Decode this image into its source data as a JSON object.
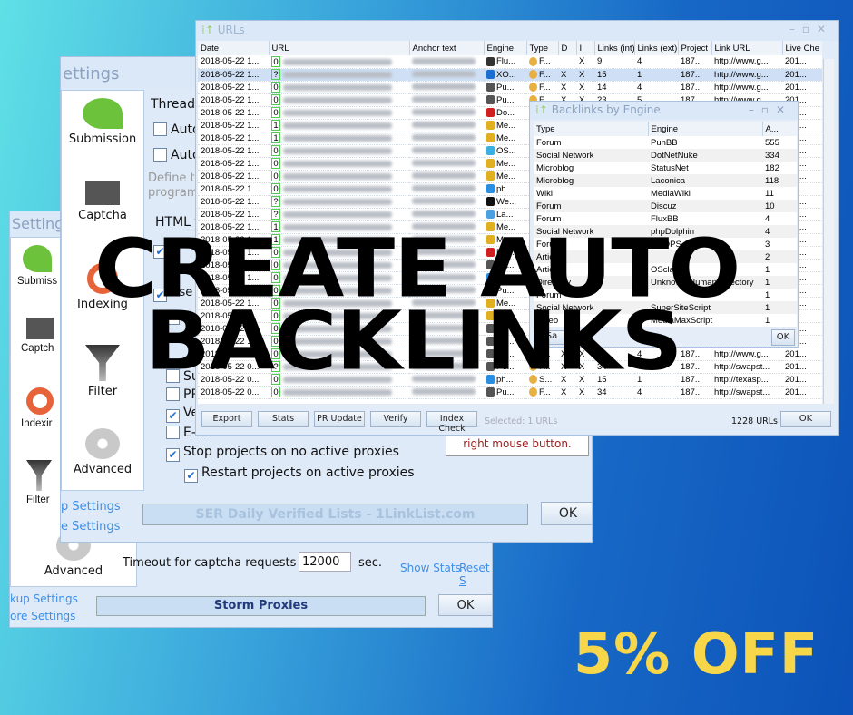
{
  "back_window": {
    "title": "Setting",
    "sidebar": [
      "Submiss",
      "Captch",
      "Indexir",
      "Filter",
      "Advanced"
    ],
    "timeout_label": "Timeout for captcha requests to solve",
    "timeout_value": "12000",
    "timeout_unit": "sec.",
    "show_stats": "Show Stats",
    "reset": "Reset S",
    "links": [
      "kup Settings",
      "ore Settings"
    ],
    "banner": "Storm Proxies",
    "ok": "OK"
  },
  "mid_window": {
    "title": "ettings",
    "sidebar": [
      "Submission",
      "Captcha",
      "Indexing",
      "Filter",
      "Advanced"
    ],
    "threads": "Threads",
    "autom1": "Autor",
    "autom2": "Autor",
    "define": "Define th",
    "program": "program s",
    "html": "HTML ti",
    "use_p": "Use p",
    "se": "Se",
    "su": "Su",
    "pr": "PR",
    "ve": "Ve",
    "em": "E-M",
    "stop": "Stop projects on no active proxies",
    "restart": "Restart projects on active proxies",
    "hint": "right mouse button.",
    "links": [
      "p Settings",
      "e Settings"
    ],
    "banner": "SER Daily Verified Lists - 1LinkList.com",
    "ok": "OK"
  },
  "urls_window": {
    "title": "URLs",
    "columns": [
      "Date",
      "URL",
      "Anchor text",
      "Engine",
      "Type",
      "D",
      "I",
      "Links (int)",
      "Links (ext)",
      "Project",
      "Link URL",
      "Live Che"
    ],
    "rows": [
      [
        "2018-05-22 1...",
        "0",
        "Flu...",
        "F...",
        "",
        "X",
        "9",
        "4",
        "187...",
        "http://www.g...",
        "201..."
      ],
      [
        "2018-05-22 1...",
        "?",
        "XO...",
        "F...",
        "X",
        "X",
        "15",
        "1",
        "187...",
        "http://www.g...",
        "201..."
      ],
      [
        "2018-05-22 1...",
        "0",
        "Pu...",
        "F...",
        "X",
        "X",
        "14",
        "4",
        "187...",
        "http://www.g...",
        "201..."
      ],
      [
        "2018-05-22 1...",
        "0",
        "Pu...",
        "F...",
        "X",
        "X",
        "23",
        "5",
        "187...",
        "http://www.g...",
        "201..."
      ],
      [
        "2018-05-22 1...",
        "0",
        "Do...",
        "",
        "",
        "",
        "",
        "",
        "",
        "",
        "201..."
      ],
      [
        "2018-05-22 1...",
        "1",
        "Me...",
        "",
        "",
        "",
        "",
        "",
        "",
        "",
        "201..."
      ],
      [
        "2018-05-22 1...",
        "1",
        "Me...",
        "",
        "",
        "",
        "",
        "",
        "",
        "",
        "201..."
      ],
      [
        "2018-05-22 1...",
        "0",
        "OS...",
        "",
        "",
        "",
        "",
        "",
        "",
        "",
        "201..."
      ],
      [
        "2018-05-22 1...",
        "0",
        "Me...",
        "",
        "",
        "",
        "",
        "",
        "",
        "",
        "201..."
      ],
      [
        "2018-05-22 1...",
        "0",
        "Me...",
        "",
        "",
        "",
        "",
        "",
        "",
        "",
        "201..."
      ],
      [
        "2018-05-22 1...",
        "0",
        "ph...",
        "",
        "",
        "",
        "",
        "",
        "",
        "",
        "201..."
      ],
      [
        "2018-05-22 1...",
        "?",
        "We...",
        "",
        "",
        "",
        "",
        "",
        "",
        "",
        "201..."
      ],
      [
        "2018-05-22 1...",
        "?",
        "La...",
        "",
        "",
        "",
        "",
        "",
        "",
        "",
        "201..."
      ],
      [
        "2018-05-22 1...",
        "1",
        "Me...",
        "",
        "",
        "",
        "",
        "",
        "",
        "",
        "201..."
      ],
      [
        "2018-05-22 1...",
        "1",
        "Me...",
        "",
        "",
        "",
        "",
        "",
        "",
        "",
        "201..."
      ],
      [
        "2018-05-22 1...",
        "0",
        "Do...",
        "",
        "",
        "",
        "",
        "",
        "",
        "",
        "201..."
      ],
      [
        "2018-05-22 1...",
        "0",
        "Pu...",
        "",
        "",
        "",
        "",
        "",
        "",
        "",
        "201..."
      ],
      [
        "2018-05-22 1...",
        "0",
        "ph...",
        "",
        "",
        "",
        "",
        "",
        "",
        "",
        "201..."
      ],
      [
        "2018-05-22 1...",
        "0",
        "Pu...",
        "",
        "",
        "",
        "",
        "",
        "",
        "",
        "201..."
      ],
      [
        "2018-05-22 1...",
        "0",
        "Me...",
        "",
        "",
        "",
        "",
        "",
        "",
        "",
        "201..."
      ],
      [
        "2018-05-22 1...",
        "0",
        "Me...",
        "",
        "",
        "",
        "",
        "",
        "",
        "",
        "201..."
      ],
      [
        "2018-05-22 1...",
        "0",
        "Pu...",
        "",
        "",
        "",
        "",
        "",
        "",
        "",
        "201..."
      ],
      [
        "2018-05-22 1...",
        "0",
        "Pu...",
        "",
        "",
        "",
        "",
        "",
        "",
        "",
        "201..."
      ],
      [
        "2018-05-22 0...",
        "0",
        "Pu...",
        "F...",
        "X",
        "X",
        "34",
        "4",
        "187...",
        "http://www.g...",
        "201..."
      ],
      [
        "2018-05-22 0...",
        "?",
        "Pu...",
        "F...",
        "X",
        "X",
        "34",
        "4",
        "187...",
        "http://swapst...",
        "201..."
      ],
      [
        "2018-05-22 0...",
        "0",
        "ph...",
        "S...",
        "X",
        "X",
        "15",
        "1",
        "187...",
        "http://texasp...",
        "201..."
      ],
      [
        "2018-05-22 0...",
        "0",
        "Pu...",
        "F...",
        "X",
        "X",
        "34",
        "4",
        "187...",
        "http://swapst...",
        "201..."
      ]
    ],
    "buttons": [
      "Export",
      "Stats",
      "PR Update",
      "Verify",
      "Index Check"
    ],
    "selected": "Selected: 1 URLs",
    "count": "1228 URLs",
    "ok": "OK"
  },
  "backlinks_dialog": {
    "title": "Backlinks by Engine",
    "columns": [
      "Type",
      "Engine",
      "A..."
    ],
    "rows": [
      [
        "Forum",
        "PunBB",
        "555"
      ],
      [
        "Social Network",
        "DotNetNuke",
        "334"
      ],
      [
        "Microblog",
        "StatusNet",
        "182"
      ],
      [
        "Microblog",
        "Laconica",
        "118"
      ],
      [
        "Wiki",
        "MediaWiki",
        "11"
      ],
      [
        "Forum",
        "Discuz",
        "10"
      ],
      [
        "Forum",
        "FluxBB",
        "4"
      ],
      [
        "Social Network",
        "phpDolphin",
        "4"
      ],
      [
        "Forum",
        "XOOPS",
        "3"
      ],
      [
        "Article",
        "",
        "2"
      ],
      [
        "Article",
        "OSclass",
        "1"
      ],
      [
        "Directory",
        "Unknown Human Directory",
        "1"
      ],
      [
        "Forum",
        "",
        "1"
      ],
      [
        "Social Network",
        "SuperSiteScript",
        "1"
      ],
      [
        "Video",
        "MediaMaxScript",
        "1"
      ]
    ],
    "save": "Sa",
    "ok": "OK"
  },
  "headline": [
    "CREATE AUTO",
    "BACKLINKS"
  ],
  "promo": "5% OFF",
  "colors": {
    "promo": "#f7d64a",
    "headline": "#000000",
    "bg_left": "#5fe0e6",
    "bg_right": "#0c52b8"
  }
}
